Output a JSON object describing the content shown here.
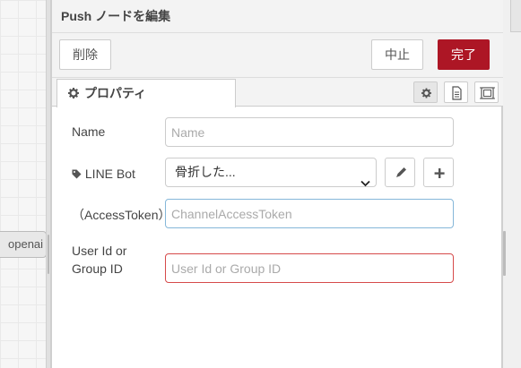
{
  "workspace": {
    "node_label": "openai"
  },
  "tray": {
    "title": "Push ノードを編集",
    "toolbar": {
      "delete_label": "削除",
      "cancel_label": "中止",
      "done_label": "完了",
      "done_color": "#ad1625"
    },
    "tabs": [
      {
        "label": "プロパティ",
        "icon": "gear-icon"
      }
    ],
    "tab_icons": [
      "gear-icon",
      "document-icon",
      "frame-icon"
    ]
  },
  "form": {
    "name": {
      "label": "Name",
      "placeholder": "Name",
      "value": ""
    },
    "line_bot": {
      "label": "LINE Bot",
      "icon": "tag-icon",
      "selected": "骨折した..."
    },
    "access_token": {
      "label": "（AccessToken）",
      "placeholder": "ChannelAccessToken",
      "value": ""
    },
    "user_id": {
      "label_line1": "User Id or",
      "label_line2": "Group ID",
      "placeholder": "User Id or Group ID",
      "value": ""
    }
  }
}
